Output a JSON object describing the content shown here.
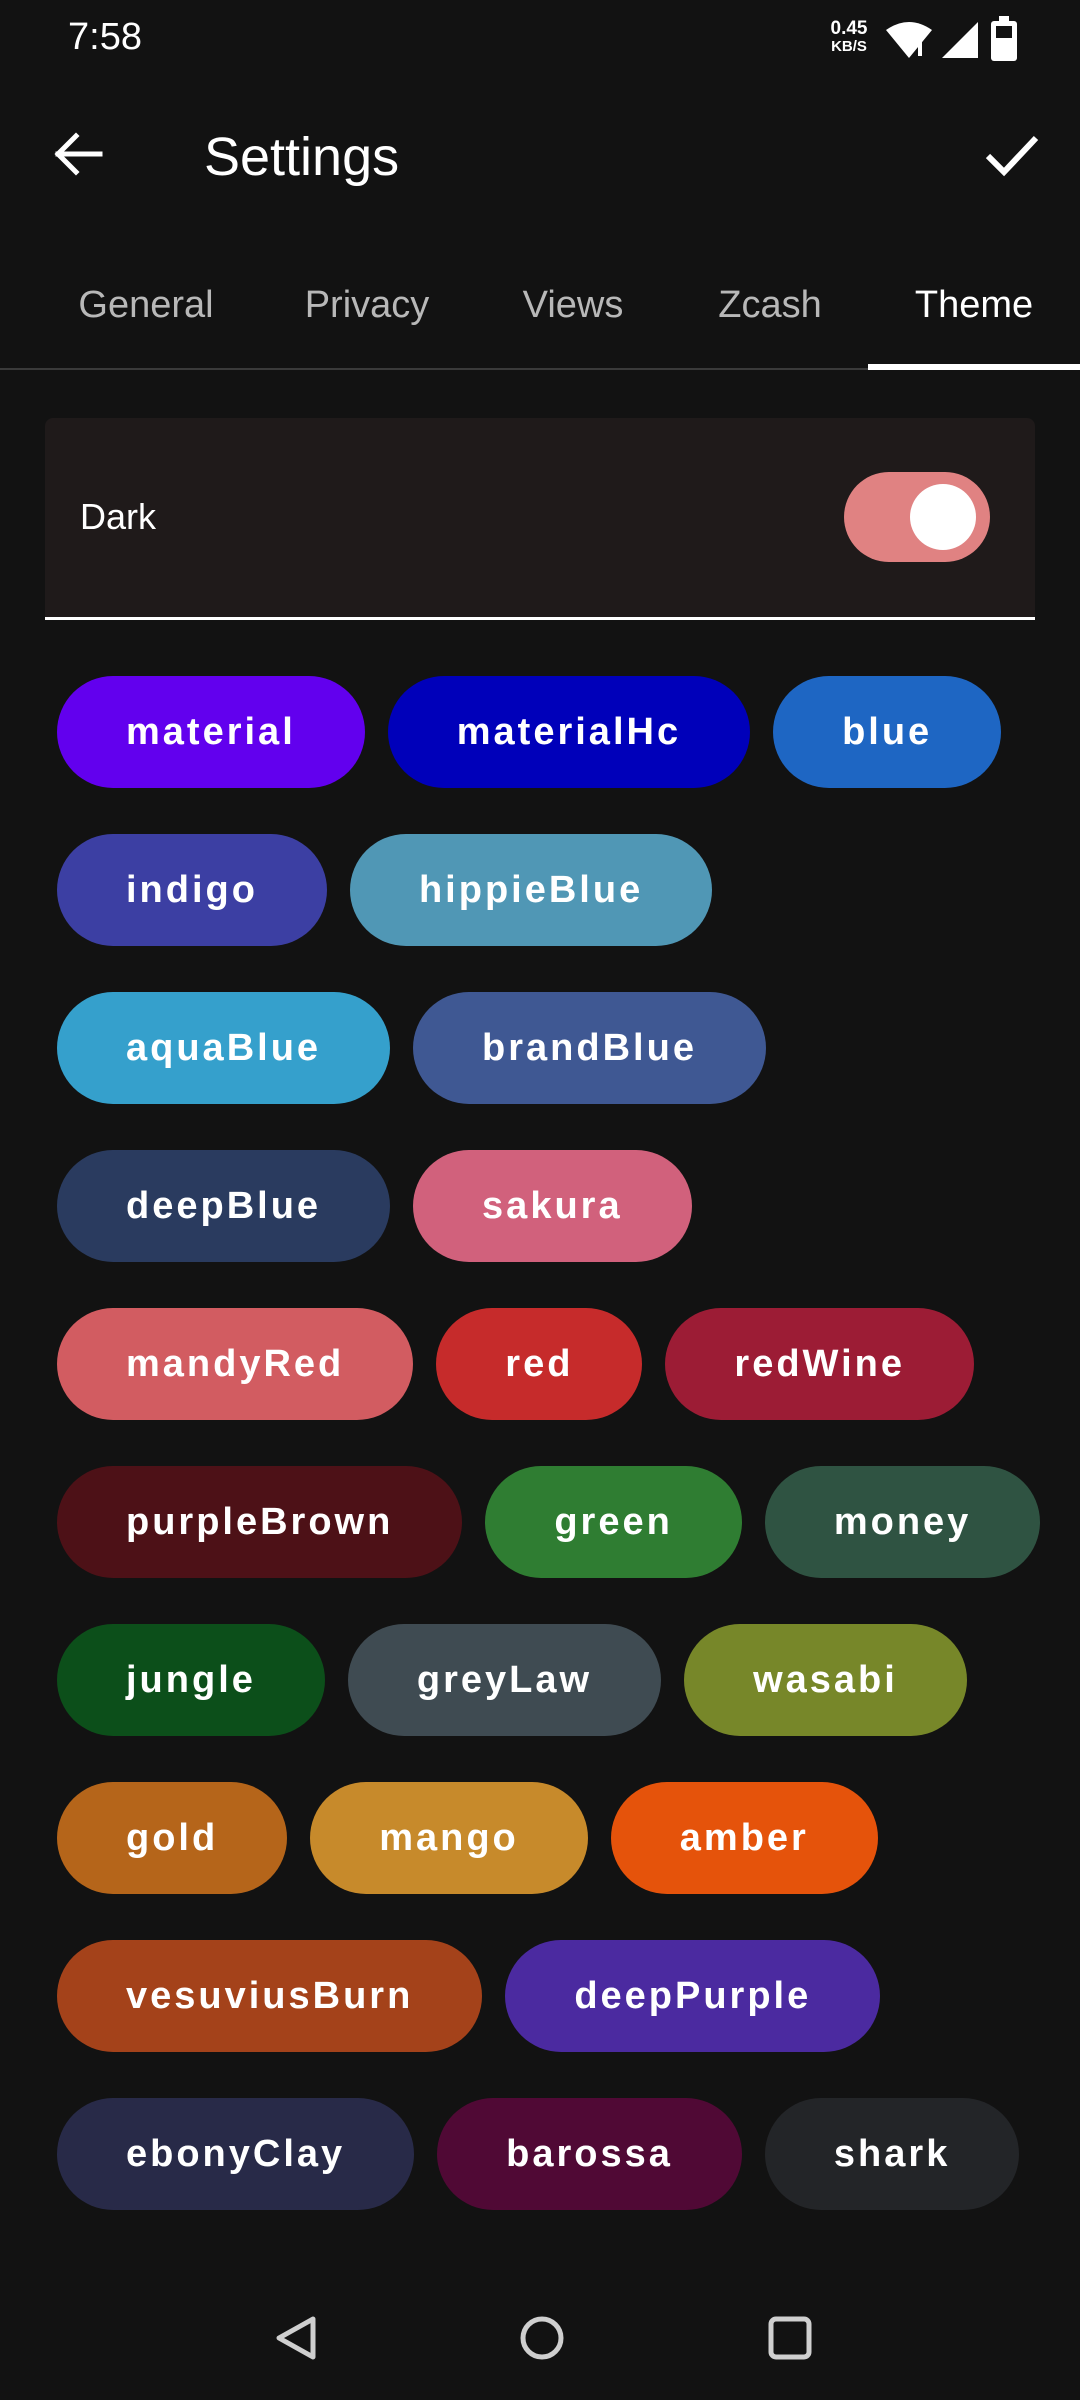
{
  "status_bar": {
    "time": "7:58",
    "net_speed_value": "0.45",
    "net_speed_unit": "KB/S",
    "icons": [
      "wifi-icon",
      "cellular-signal-icon",
      "battery-icon"
    ]
  },
  "app_bar": {
    "title": "Settings",
    "back_icon": "arrow-back-icon",
    "confirm_icon": "check-icon"
  },
  "tabs": [
    {
      "label": "General",
      "active": false
    },
    {
      "label": "Privacy",
      "active": false
    },
    {
      "label": "Views",
      "active": false
    },
    {
      "label": "Zcash",
      "active": false
    },
    {
      "label": "Theme",
      "active": true
    }
  ],
  "dark_mode": {
    "label": "Dark",
    "enabled": true,
    "switch_color": "#e08282"
  },
  "themes": [
    {
      "label": "material",
      "color": "#6200ee"
    },
    {
      "label": "materialHc",
      "color": "#0000ba"
    },
    {
      "label": "blue",
      "color": "#1e66c3"
    },
    {
      "label": "indigo",
      "color": "#3c3fa3"
    },
    {
      "label": "hippieBlue",
      "color": "#5097b5"
    },
    {
      "label": "aquaBlue",
      "color": "#35a0cc"
    },
    {
      "label": "brandBlue",
      "color": "#3f5893"
    },
    {
      "label": "deepBlue",
      "color": "#2a3b5f"
    },
    {
      "label": "sakura",
      "color": "#d1617c"
    },
    {
      "label": "mandyRed",
      "color": "#d25c61"
    },
    {
      "label": "red",
      "color": "#c62b2b"
    },
    {
      "label": "redWine",
      "color": "#9c1c35"
    },
    {
      "label": "purpleBrown",
      "color": "#4d1117"
    },
    {
      "label": "green",
      "color": "#2f7d32"
    },
    {
      "label": "money",
      "color": "#2f5342"
    },
    {
      "label": "jungle",
      "color": "#0c4f1a"
    },
    {
      "label": "greyLaw",
      "color": "#3f4b52"
    },
    {
      "label": "wasabi",
      "color": "#778729"
    },
    {
      "label": "gold",
      "color": "#b5651a"
    },
    {
      "label": "mango",
      "color": "#c78a2b"
    },
    {
      "label": "amber",
      "color": "#e5530b"
    },
    {
      "label": "vesuviusBurn",
      "color": "#a4421a"
    },
    {
      "label": "deepPurple",
      "color": "#4b2aa0"
    },
    {
      "label": "ebonyClay",
      "color": "#282a48"
    },
    {
      "label": "barossa",
      "color": "#500935"
    },
    {
      "label": "shark",
      "color": "#232528"
    }
  ],
  "nav_bar": {
    "icons": [
      "nav-back-icon",
      "nav-home-icon",
      "nav-recents-icon"
    ]
  }
}
